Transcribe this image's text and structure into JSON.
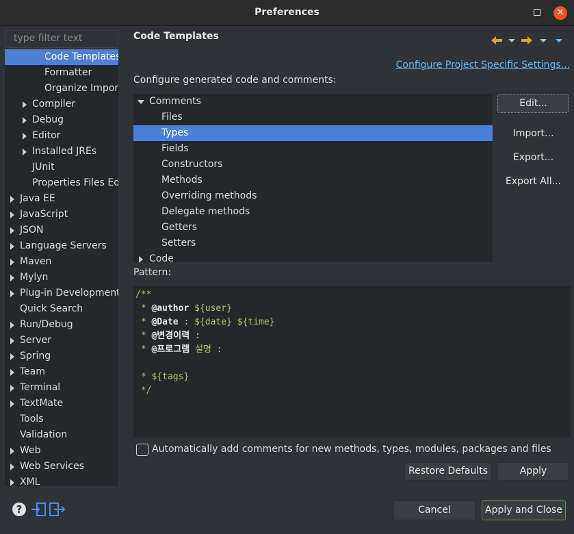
{
  "window": {
    "title": "Preferences",
    "close_glyph": "✕"
  },
  "filter": {
    "placeholder": "type filter text"
  },
  "nav": {
    "code_templates": "Code Templates",
    "formatter": "Formatter",
    "organize_imports": "Organize Imports",
    "compiler": "Compiler",
    "debug": "Debug",
    "editor": "Editor",
    "installed_jres": "Installed JREs",
    "junit": "JUnit",
    "properties_files_editor": "Properties Files Editor",
    "java_ee": "Java EE",
    "javascript": "JavaScript",
    "json": "JSON",
    "language_servers": "Language Servers",
    "maven": "Maven",
    "mylyn": "Mylyn",
    "plugin_development": "Plug-in Development",
    "quick_search": "Quick Search",
    "run_debug": "Run/Debug",
    "server": "Server",
    "spring": "Spring",
    "team": "Team",
    "terminal": "Terminal",
    "textmate": "TextMate",
    "tools": "Tools",
    "validation": "Validation",
    "web": "Web",
    "web_services": "Web Services",
    "xml": "XML"
  },
  "header": {
    "title": "Code Templates",
    "configure_link": "Configure Project Specific Settings...",
    "configure_label": "Configure generated code and comments:"
  },
  "templates": {
    "comments": "Comments",
    "files": "Files",
    "types": "Types",
    "fields": "Fields",
    "constructors": "Constructors",
    "methods": "Methods",
    "overriding_methods": "Overriding methods",
    "delegate_methods": "Delegate methods",
    "getters": "Getters",
    "setters": "Setters",
    "code": "Code"
  },
  "buttons": {
    "edit": "Edit...",
    "import": "Import...",
    "export": "Export...",
    "export_all": "Export All...",
    "restore_defaults": "Restore Defaults",
    "apply": "Apply",
    "cancel": "Cancel",
    "apply_close": "Apply and Close"
  },
  "pattern": {
    "label": "Pattern:",
    "l1": "/**",
    "l2_prefix": " * ",
    "l2_tag": "@author",
    "l2_rest": " ${user}",
    "l3_prefix": " * ",
    "l3_tag": "@Date",
    "l3_rest": " : ${date} ${time}",
    "l4_prefix": " * ",
    "l4_tag": "@변경이력",
    "l4_rest": " :",
    "l5_prefix": " * ",
    "l5_tag": "@프로그램",
    "l5_rest": " 설명 :",
    "l6": "",
    "l7": " * ${tags}",
    "l8": " */"
  },
  "auto_comments": {
    "label": "Automatically add comments for new methods, types, modules, packages and files",
    "checked": false
  },
  "footer": {
    "help_glyph": "?"
  },
  "colors": {
    "selection": "#4a80d8",
    "arrow_accent": "#d9a43b",
    "link": "#6cb8f2",
    "close": "#e95420"
  }
}
